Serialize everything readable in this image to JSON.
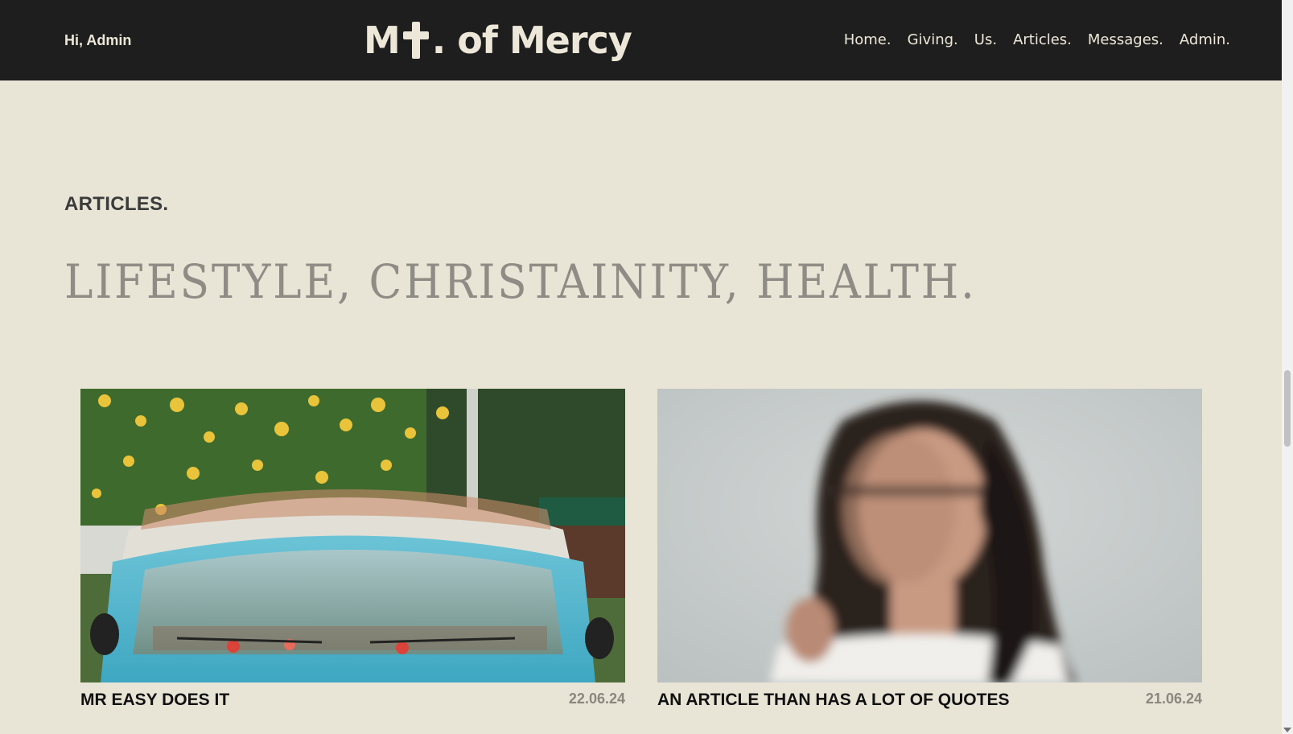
{
  "header": {
    "greeting": "Hi, Admin",
    "logo_prefix": "M",
    "logo_suffix": ". of Mercy",
    "nav": [
      "Home.",
      "Giving.",
      "Us.",
      "Articles.",
      "Messages.",
      "Admin."
    ]
  },
  "section": {
    "label": "ARTICLES.",
    "title": "LIFESTYLE, CHRISTAINITY, HEALTH."
  },
  "articles": [
    {
      "title": "MR EASY DOES IT",
      "date": "22.06.24"
    },
    {
      "title": "AN ARTICLE THAN HAS A LOT OF QUOTES",
      "date": "21.06.24"
    }
  ],
  "colors": {
    "background": "#e8e4d6",
    "topbar": "#1e1e1e",
    "topbar_text": "#ece7d8"
  }
}
